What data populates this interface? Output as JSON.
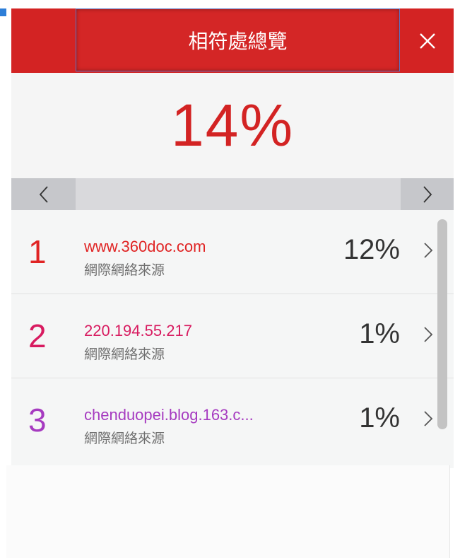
{
  "header": {
    "title": "相符處總覽"
  },
  "overall_match": "14%",
  "colors": {
    "header_red": "#d32323",
    "row1": "#e02424",
    "row2": "#d81b60",
    "row3": "#a63bc0"
  },
  "icons": {
    "close": "close-icon",
    "prev": "chevron-left-icon",
    "next": "chevron-right-icon",
    "row_arrow": "chevron-right-icon"
  },
  "sources": [
    {
      "rank": "1",
      "source": "www.360doc.com",
      "type": "網際網絡來源",
      "percent": "12%"
    },
    {
      "rank": "2",
      "source": "220.194.55.217",
      "type": "網際網絡來源",
      "percent": "1%"
    },
    {
      "rank": "3",
      "source": "chenduopei.blog.163.c...",
      "type": "網際網絡來源",
      "percent": "1%"
    }
  ]
}
